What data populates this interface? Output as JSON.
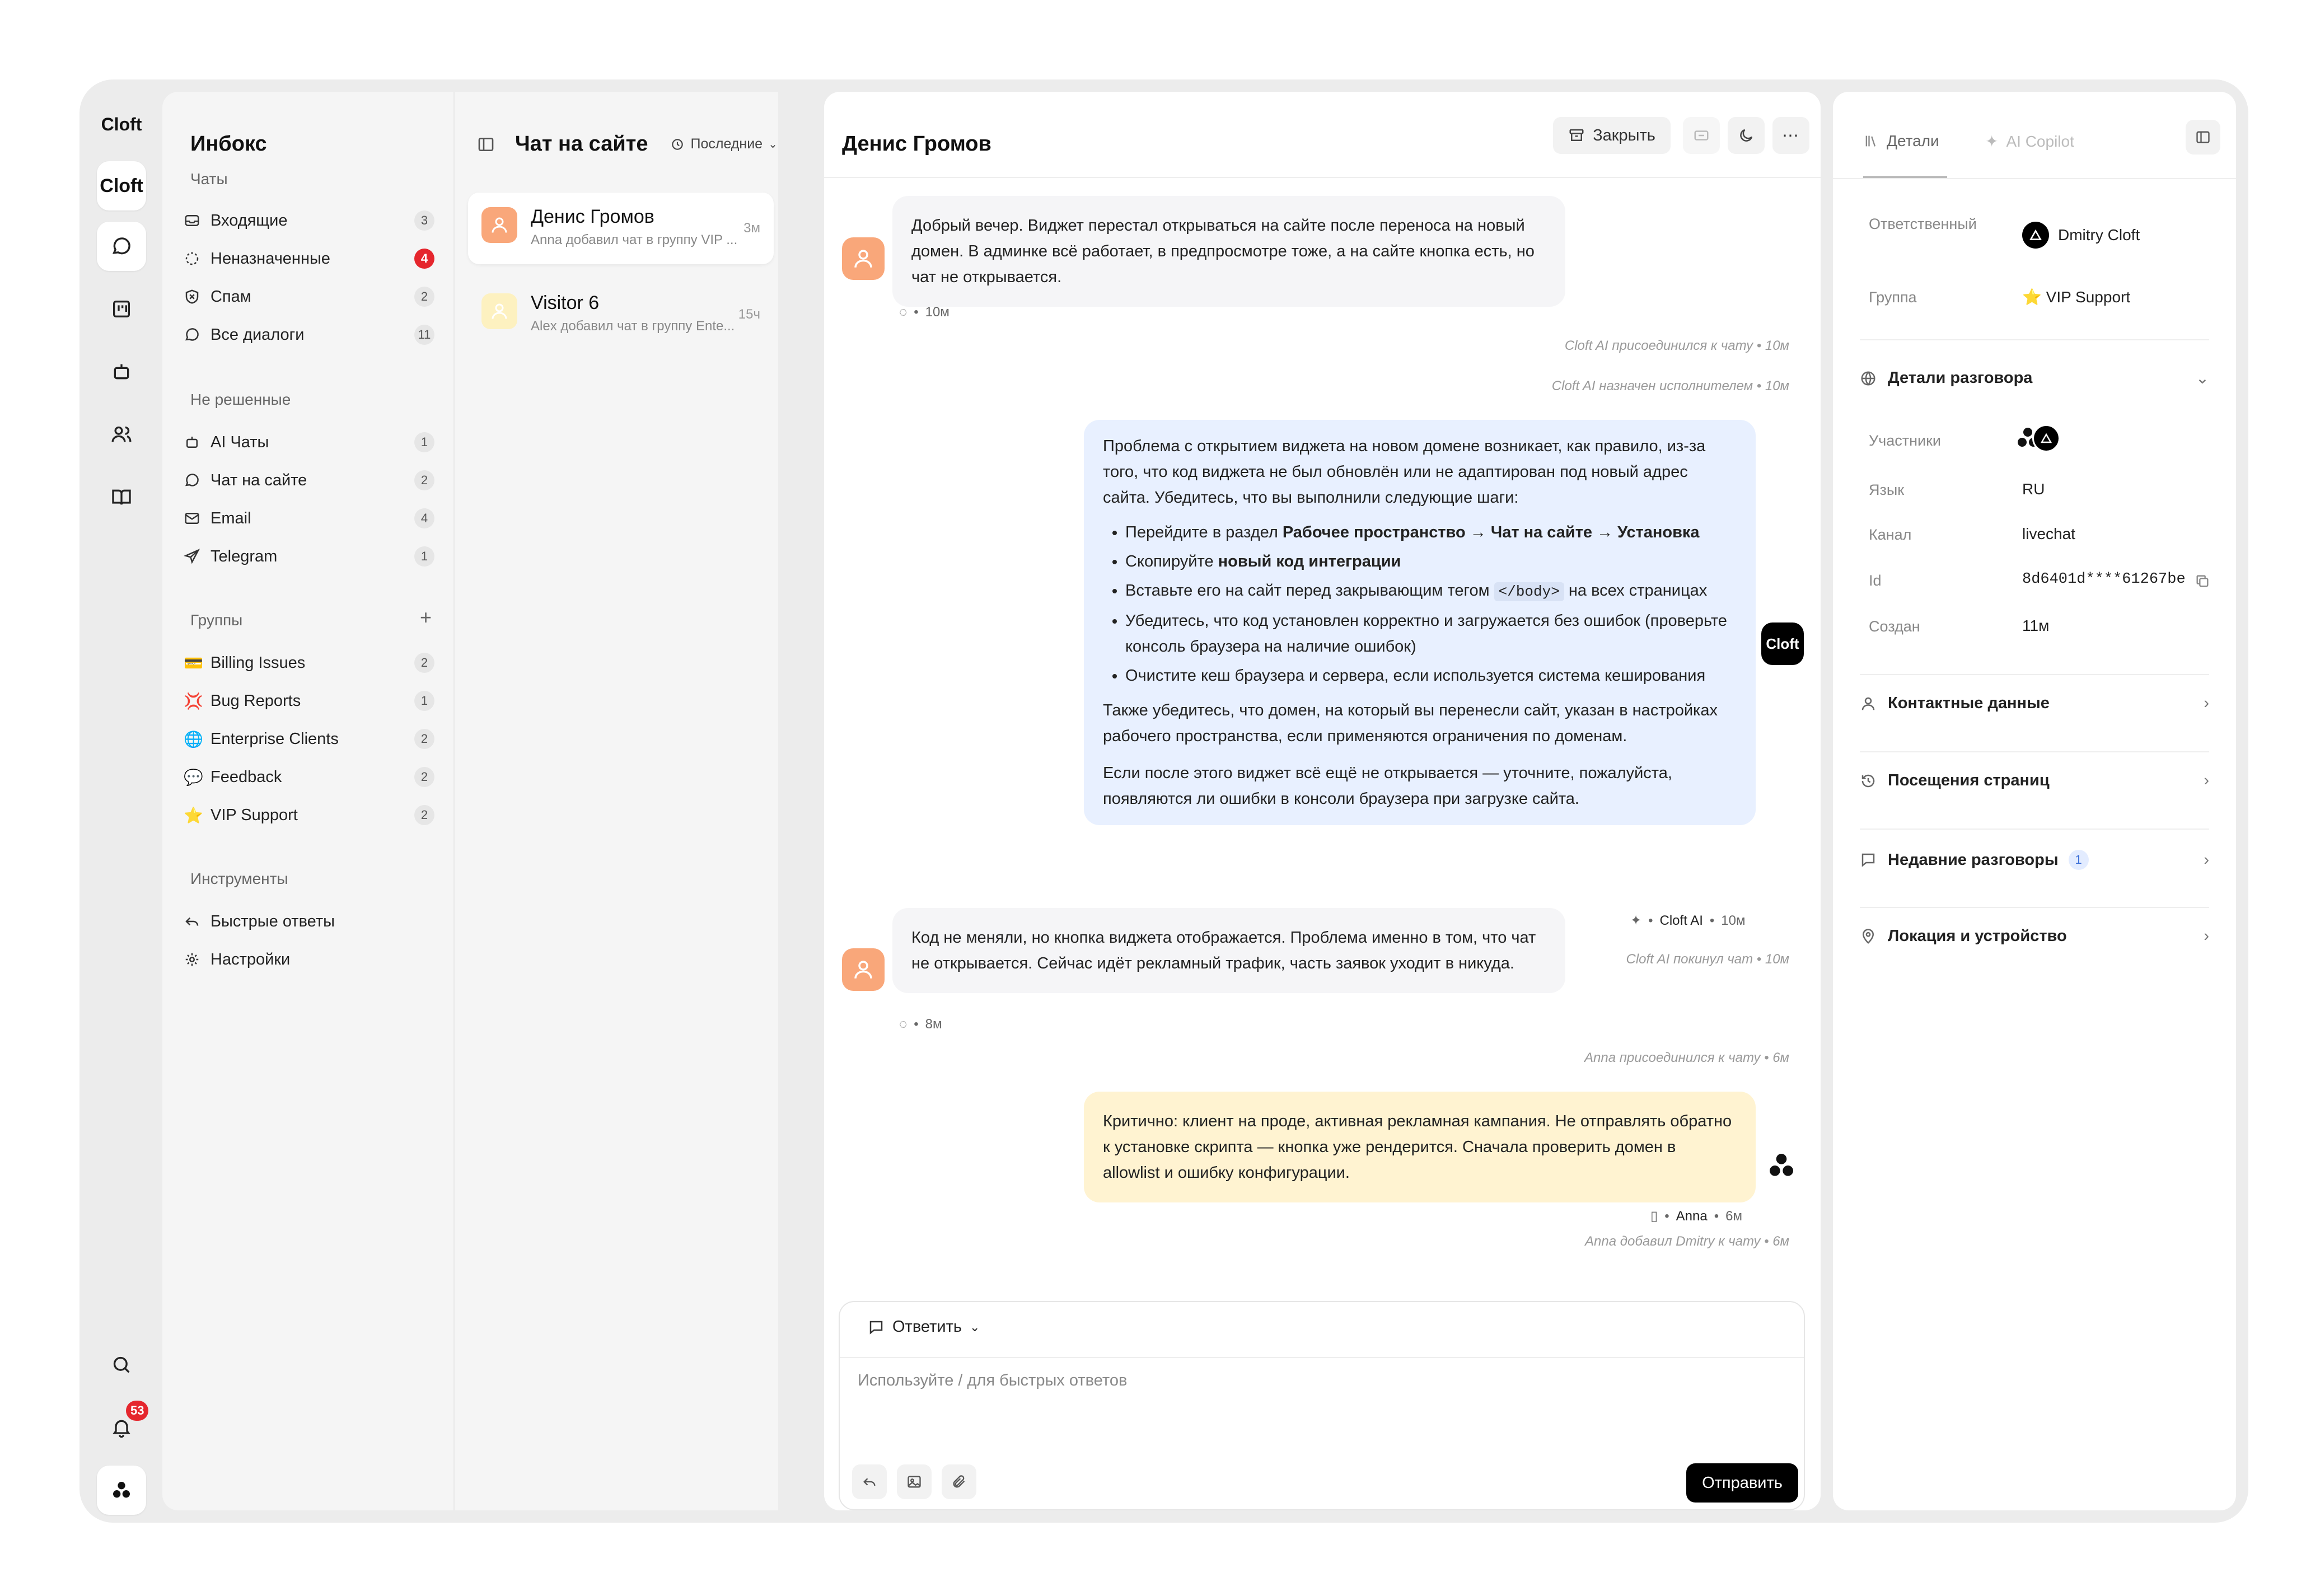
{
  "rail": {
    "logo": "Cloft",
    "workspace": "Cloft",
    "notifications_badge": "53"
  },
  "sidebar": {
    "title": "Инбокс",
    "sections": {
      "chats": "Чаты",
      "unresolved": "Не решенные",
      "groups": "Группы",
      "tools": "Инструменты"
    },
    "chats": [
      {
        "label": "Входящие",
        "count": "3"
      },
      {
        "label": "Неназначенные",
        "count": "4"
      },
      {
        "label": "Спам",
        "count": "2"
      },
      {
        "label": "Все диалоги",
        "count": "11"
      }
    ],
    "unresolved": [
      {
        "label": "AI Чаты",
        "count": "1"
      },
      {
        "label": "Чат на сайте",
        "count": "2"
      },
      {
        "label": "Email",
        "count": "4"
      },
      {
        "label": "Telegram",
        "count": "1"
      }
    ],
    "groups": [
      {
        "label": "Billing Issues",
        "count": "2",
        "emoji": "💳"
      },
      {
        "label": "Bug Reports",
        "count": "1",
        "emoji": "💢"
      },
      {
        "label": "Enterprise Clients",
        "count": "2",
        "emoji": "🌐"
      },
      {
        "label": "Feedback",
        "count": "2",
        "emoji": "💬"
      },
      {
        "label": "VIP Support",
        "count": "2",
        "emoji": "⭐"
      }
    ],
    "tools": [
      {
        "label": "Быстрые ответы"
      },
      {
        "label": "Настройки"
      }
    ],
    "add_group": "+"
  },
  "chatlist": {
    "title": "Чат на сайте",
    "sort": "Последние",
    "items": [
      {
        "name": "Денис Громов",
        "preview": "Anna добавил чат в группу VIP ...",
        "time": "3м"
      },
      {
        "name": "Visitor 6",
        "preview": "Alex добавил чат в группу Ente...",
        "time": "15ч"
      }
    ]
  },
  "main": {
    "title": "Денис Громов",
    "close_label": "Закрыть",
    "messages": {
      "m1": "Добрый вечер. Виджет перестал открываться на сайте после переноса на новый домен. В админке всё работает, в предпросмотре тоже, а на сайте кнопка есть, но чат не открывается.",
      "m1_time": "10м",
      "sys1": "Cloft AI присоединился к чату • 10м",
      "sys2": "Cloft AI назначен исполнителем • 10м",
      "ai_intro": "Проблема с открытием виджета на новом домене возникает, как правило, из-за того, что код виджета не был обновлён или не адаптирован под новый адрес сайта. Убедитесь, что вы выполнили следующие шаги:",
      "ai_b1_pre": "Перейдите в раздел ",
      "ai_b1_bold": "Рабочее пространство → Чат на сайте → Установка",
      "ai_b2_pre": "Скопируйте ",
      "ai_b2_bold": "новый код интеграции",
      "ai_b3_pre": "Вставьте его на сайт перед закрывающим тегом ",
      "ai_b3_code": "</body>",
      "ai_b3_post": " на всех страницах",
      "ai_b4": "Убедитесь, что код установлен корректно и загружается без ошибок (проверьте консоль браузера на наличие ошибок)",
      "ai_b5": "Очистите кеш браузера и сервера, если используется система кеширования",
      "ai_p2": "Также убедитесь, что домен, на который вы перенесли сайт, указан в настройках рабочего пространства, если применяются ограничения по доменам.",
      "ai_p3": "Если после этого виджет всё ещё не открывается — уточните, пожалуйста, появляются ли ошибки в консоли браузера при загрузке сайта.",
      "ai_author": "Cloft AI",
      "ai_time": "10м",
      "ai_avatar": "Cloft",
      "sys3": "Cloft AI покинул чат • 10м",
      "m2": "Код не меняли, но кнопка виджета отображается. Проблема именно в том, что чат не открывается. Сейчас идёт рекламный трафик, часть заявок уходит в никуда.",
      "m2_time": "8м",
      "sys4": "Anna присоединился к чату • 6м",
      "note": "Критично: клиент на проде, активная рекламная кампания. Не отправлять обратно к установке скрипта — кнопка уже рендерится. Сначала проверить домен в allowlist и ошибку конфигурации.",
      "note_author": "Anna",
      "note_time": "6м",
      "sys5": "Anna добавил Dmitry к чату • 6м"
    },
    "composer": {
      "mode": "Ответить",
      "placeholder": "Используйте / для быстрых ответов",
      "send": "Отправить"
    }
  },
  "right": {
    "tab_details": "Детали",
    "tab_copilot": "AI Copilot",
    "assignee_label": "Ответственный",
    "assignee": "Dmitry Cloft",
    "group_label": "Группа",
    "group": "VIP Support",
    "conv_details": "Детали разговора",
    "participants_label": "Участники",
    "lang_label": "Язык",
    "lang": "RU",
    "channel_label": "Канал",
    "channel": "livechat",
    "id_label": "Id",
    "id": "8d6401d****61267be",
    "created_label": "Создан",
    "created": "11м",
    "contact": "Контактные данные",
    "visits": "Посещения страниц",
    "recent": "Недавние разговоры",
    "recent_count": "1",
    "location": "Локация и устройство"
  }
}
